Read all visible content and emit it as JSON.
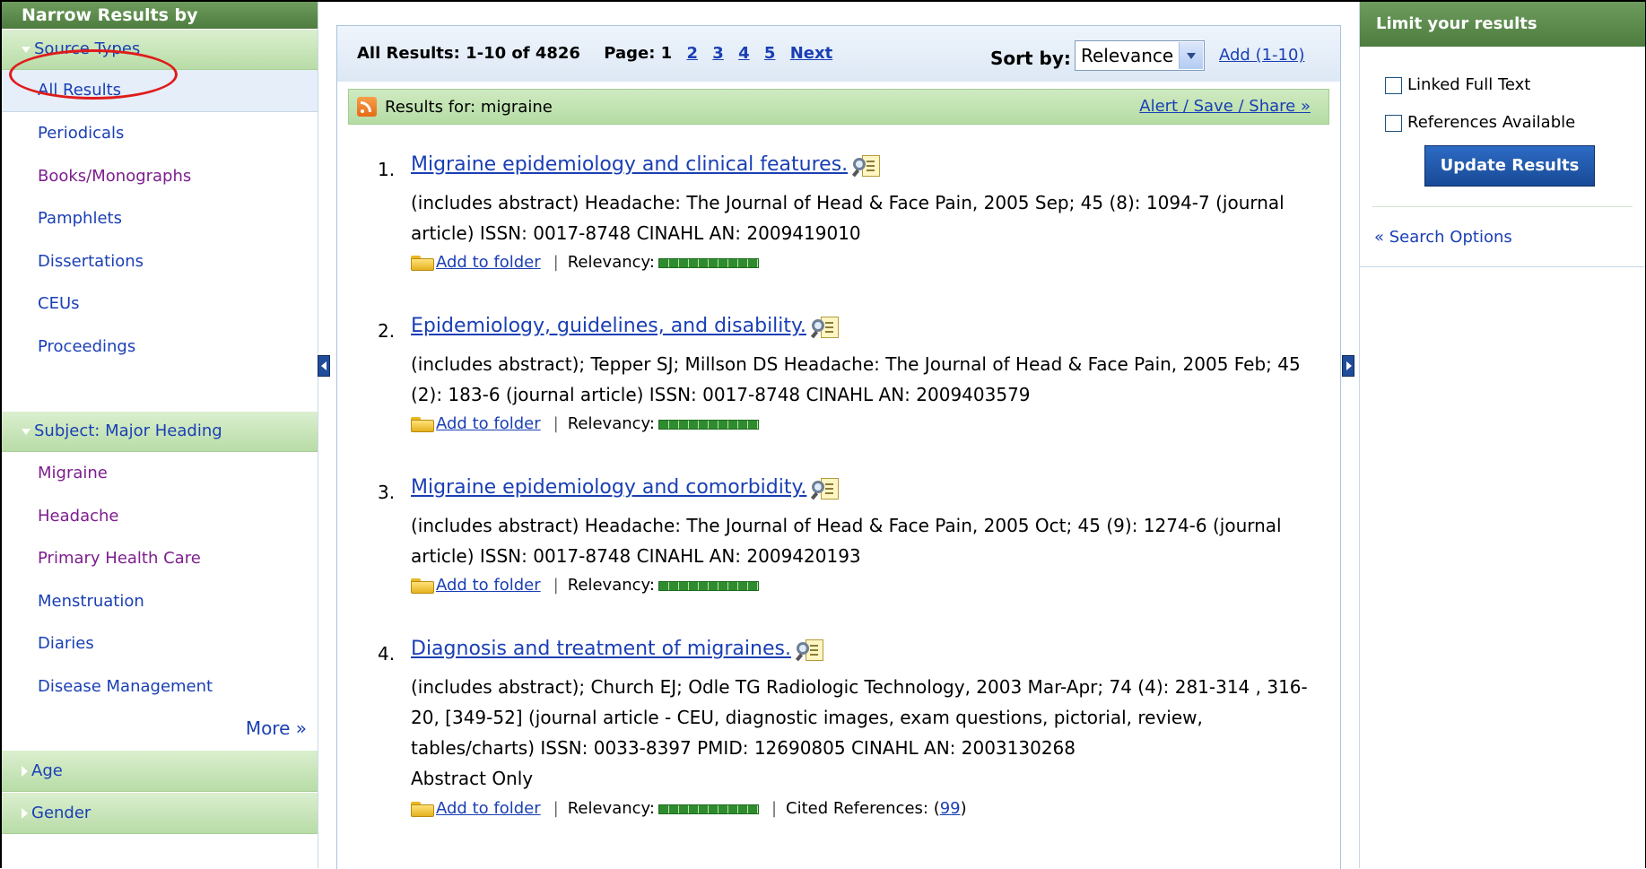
{
  "left": {
    "header": "Narrow Results by",
    "source_types": {
      "title": "Source Types",
      "items": [
        {
          "label": "All Results"
        },
        {
          "label": "Periodicals"
        },
        {
          "label": "Books/Monographs"
        },
        {
          "label": "Pamphlets"
        },
        {
          "label": "Dissertations"
        },
        {
          "label": "CEUs"
        },
        {
          "label": "Proceedings"
        }
      ]
    },
    "subject": {
      "title": "Subject: Major Heading",
      "items": [
        {
          "label": "Migraine"
        },
        {
          "label": "Headache"
        },
        {
          "label": "Primary Health Care"
        },
        {
          "label": "Menstruation"
        },
        {
          "label": "Diaries"
        },
        {
          "label": "Disease Management"
        }
      ],
      "more": "More »"
    },
    "age": "Age",
    "gender": "Gender"
  },
  "center": {
    "summary": "All Results: 1-10 of 4826",
    "page_label": "Page: 1",
    "pages": [
      "2",
      "3",
      "4",
      "5"
    ],
    "next": "Next",
    "sort_label": "Sort by:",
    "sort_value": "Relevance",
    "add_link": "Add (1-10)",
    "results_for": "Results for: migraine",
    "alert_link": "Alert / Save / Share »",
    "results": [
      {
        "num": "1.",
        "title": "Migraine epidemiology and clinical features.",
        "desc": "(includes abstract) Headache: The Journal of Head & Face Pain, 2005 Sep; 45 (8): 1094-7 (journal article) ISSN: 0017-8748 CINAHL AN: 2009419010",
        "extra": "",
        "add": "Add to folder",
        "relevancy": "Relevancy:",
        "cited_label": "",
        "cited_count": ""
      },
      {
        "num": "2.",
        "title": "Epidemiology, guidelines, and disability.",
        "desc": "(includes abstract); Tepper SJ; Millson DS Headache: The Journal of Head & Face Pain, 2005 Feb; 45 (2): 183-6 (journal article) ISSN: 0017-8748 CINAHL AN: 2009403579",
        "extra": "",
        "add": "Add to folder",
        "relevancy": "Relevancy:",
        "cited_label": "",
        "cited_count": ""
      },
      {
        "num": "3.",
        "title": "Migraine epidemiology and comorbidity.",
        "desc": "(includes abstract) Headache: The Journal of Head & Face Pain, 2005 Oct; 45 (9): 1274-6 (journal article) ISSN: 0017-8748 CINAHL AN: 2009420193",
        "extra": "",
        "add": "Add to folder",
        "relevancy": "Relevancy:",
        "cited_label": "",
        "cited_count": ""
      },
      {
        "num": "4.",
        "title": "Diagnosis and treatment of migraines.",
        "desc": "(includes abstract); Church EJ; Odle TG Radiologic Technology, 2003 Mar-Apr; 74 (4): 281-314 , 316-20, [349-52] (journal article - CEU, diagnostic images, exam questions, pictorial, review, tables/charts) ISSN: 0033-8397 PMID: 12690805 CINAHL AN: 2003130268",
        "extra": "Abstract Only",
        "add": "Add to folder",
        "relevancy": "Relevancy:",
        "cited_label": "Cited References:",
        "cited_count": "99"
      }
    ]
  },
  "right": {
    "header": "Limit your results",
    "linked_full_text": "Linked Full Text",
    "references_available": "References Available",
    "update_button": "Update Results",
    "search_options": "« Search Options"
  },
  "icons": [
    "rss-icon",
    "magnify-doc-icon",
    "folder-icon",
    "collapse-left-icon",
    "expand-right-icon"
  ]
}
